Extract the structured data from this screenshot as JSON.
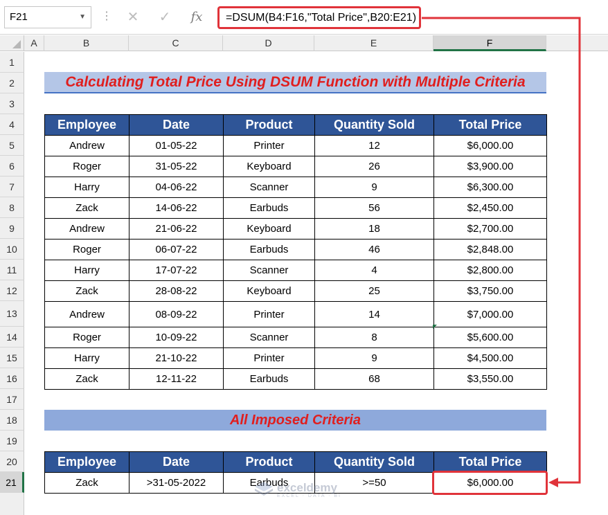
{
  "formula_bar": {
    "name_box": "F21",
    "cancel_icon": "close-icon",
    "enter_icon": "check-icon",
    "fx_label": "fx",
    "formula": "=DSUM(B4:F16,\"Total Price\",B20:E21)"
  },
  "columns": [
    "A",
    "B",
    "C",
    "D",
    "E",
    "F"
  ],
  "rows": [
    "1",
    "2",
    "3",
    "4",
    "5",
    "6",
    "7",
    "8",
    "9",
    "10",
    "11",
    "12",
    "13",
    "14",
    "15",
    "16",
    "17",
    "18",
    "19",
    "20",
    "21"
  ],
  "title": "Calculating Total Price Using DSUM Function with Multiple Criteria",
  "table": {
    "headers": [
      "Employee",
      "Date",
      "Product",
      "Quantity Sold",
      "Total Price"
    ],
    "rows": [
      [
        "Andrew",
        "01-05-22",
        "Printer",
        "12",
        "$6,000.00"
      ],
      [
        "Roger",
        "31-05-22",
        "Keyboard",
        "26",
        "$3,900.00"
      ],
      [
        "Harry",
        "04-06-22",
        "Scanner",
        "9",
        "$6,300.00"
      ],
      [
        "Zack",
        "14-06-22",
        "Earbuds",
        "56",
        "$2,450.00"
      ],
      [
        "Andrew",
        "21-06-22",
        "Keyboard",
        "18",
        "$2,700.00"
      ],
      [
        "Roger",
        "06-07-22",
        "Earbuds",
        "46",
        "$2,848.00"
      ],
      [
        "Harry",
        "17-07-22",
        "Scanner",
        "4",
        "$2,800.00"
      ],
      [
        "Zack",
        "28-08-22",
        "Keyboard",
        "25",
        "$3,750.00"
      ],
      [
        "Andrew",
        "08-09-22",
        "Printer",
        "14",
        "$7,000.00"
      ],
      [
        "Roger",
        "10-09-22",
        "Scanner",
        "8",
        "$5,600.00"
      ],
      [
        "Harry",
        "21-10-22",
        "Printer",
        "9",
        "$4,500.00"
      ],
      [
        "Zack",
        "12-11-22",
        "Earbuds",
        "68",
        "$3,550.00"
      ]
    ]
  },
  "criteria_title": "All Imposed Criteria",
  "criteria": {
    "headers": [
      "Employee",
      "Date",
      "Product",
      "Quantity Sold",
      "Total Price"
    ],
    "row": [
      "Zack",
      ">31-05-2022",
      "Earbuds",
      ">=50",
      "$6,000.00"
    ]
  },
  "watermark": {
    "name": "exceldemy",
    "sub": "EXCEL · DATA · BI"
  },
  "colors": {
    "accent_red": "#e0333a",
    "header_blue": "#2f5597",
    "banner_light": "#b4c6e7",
    "banner_mid": "#8ea9db",
    "excel_green": "#217346"
  }
}
